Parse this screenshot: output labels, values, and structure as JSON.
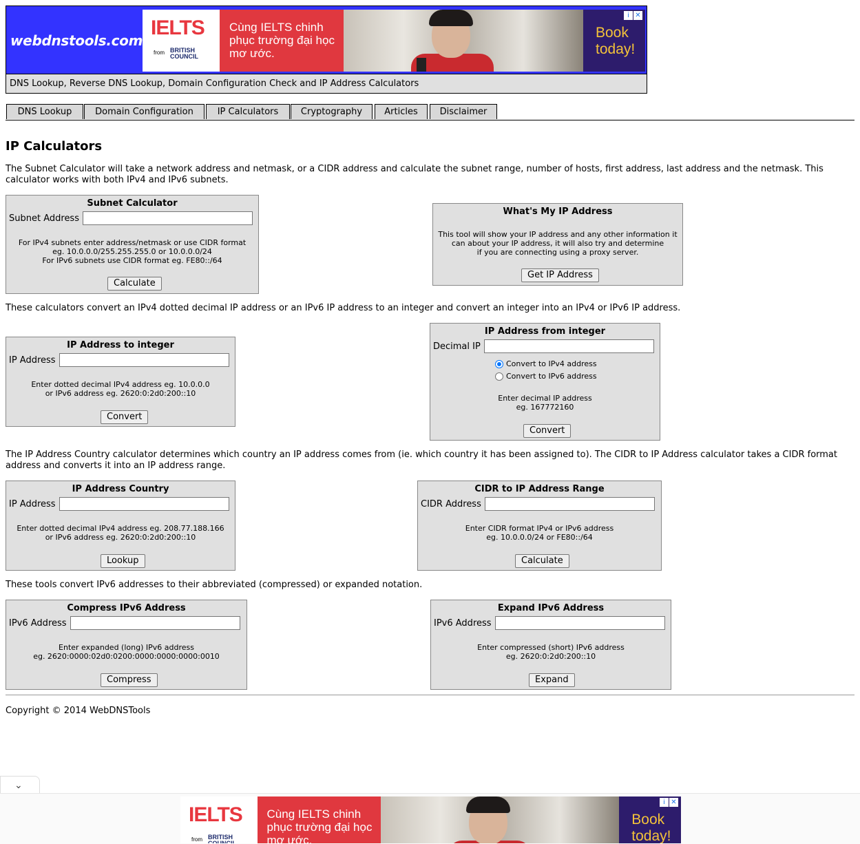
{
  "header": {
    "logo": "webdnstools.com",
    "tagline": "DNS Lookup, Reverse DNS Lookup, Domain Configuration Check and IP Address Calculators"
  },
  "ad": {
    "brand": "IELTS",
    "from": "from",
    "council": "BRITISH COUNCIL",
    "slogan": "Cùng IELTS chinh phục trường đại học mơ ước.",
    "cta": "Book today!",
    "adchoices_icon": "i",
    "close_icon": "✕"
  },
  "tabs": [
    "DNS Lookup",
    "Domain Configuration",
    "IP Calculators",
    "Cryptography",
    "Articles",
    "Disclaimer"
  ],
  "page": {
    "title": "IP Calculators",
    "intro_subnet": "The Subnet Calculator will take a network address and netmask, or a CIDR address and calculate the subnet range, number of hosts, first address, last address and the netmask. This calculator works with both IPv4 and IPv6 subnets.",
    "intro_integer": "These calculators convert an IPv4 dotted decimal IP address or an IPv6 IP address to an integer and convert an integer into an IPv4 or IPv6 IP address.",
    "intro_country": "The IP Address Country calculator determines which country an IP address comes from (ie. which country it has been assigned to). The CIDR to IP Address calculator takes a CIDR format address and converts it into an IP address range.",
    "intro_ipv6": "These tools convert IPv6 addresses to their abbreviated (compressed) or expanded notation."
  },
  "subnet": {
    "title": "Subnet Calculator",
    "label": "Subnet Address",
    "value": "",
    "hint1": "For IPv4 subnets enter address/netmask or use CIDR format",
    "hint2": "eg. 10.0.0.0/255.255.255.0 or 10.0.0.0/24",
    "hint3": "For IPv6 subnets use CIDR format eg. FE80::/64",
    "button": "Calculate"
  },
  "myip": {
    "title": "What's My IP Address",
    "hint1": "This tool will show your IP address and any other information it",
    "hint2": "can about your IP address, it will also try and determine",
    "hint3": "if you are connecting using a proxy server.",
    "button": "Get IP Address"
  },
  "ip_to_int": {
    "title": "IP Address to integer",
    "label": "IP Address",
    "value": "",
    "hint1": "Enter dotted decimal IPv4 address eg. 10.0.0.0",
    "hint2": "or IPv6 address eg. 2620:0:2d0:200::10",
    "button": "Convert"
  },
  "int_to_ip": {
    "title": "IP Address from integer",
    "label": "Decimal IP",
    "value": "",
    "radio_v4": "Convert to IPv4 address",
    "radio_v6": "Convert to IPv6 address",
    "selected": "IPv4",
    "hint1": "Enter decimal IP address",
    "hint2": "eg. 167772160",
    "button": "Convert"
  },
  "country": {
    "title": "IP Address Country",
    "label": "IP Address",
    "value": "",
    "hint1": "Enter dotted decimal IPv4 address eg. 208.77.188.166",
    "hint2": "or IPv6 address eg. 2620:0:2d0:200::10",
    "button": "Lookup"
  },
  "cidr": {
    "title": "CIDR to IP Address Range",
    "label": "CIDR Address",
    "value": "",
    "hint1": "Enter CIDR format IPv4 or IPv6 address",
    "hint2": "eg. 10.0.0.0/24 or FE80::/64",
    "button": "Calculate"
  },
  "compress": {
    "title": "Compress IPv6 Address",
    "label": "IPv6 Address",
    "value": "",
    "hint1": "Enter expanded (long) IPv6 address",
    "hint2": "eg. 2620:0000:02d0:0200:0000:0000:0000:0010",
    "button": "Compress"
  },
  "expand": {
    "title": "Expand IPv6 Address",
    "label": "IPv6 Address",
    "value": "",
    "hint1": "Enter compressed (short) IPv6 address",
    "hint2": "eg. 2620:0:2d0:200::10",
    "button": "Expand"
  },
  "footer": {
    "copyright": "Copyright © 2014 WebDNSTools"
  },
  "anchor": {
    "collapse_icon": "chevron-down"
  }
}
